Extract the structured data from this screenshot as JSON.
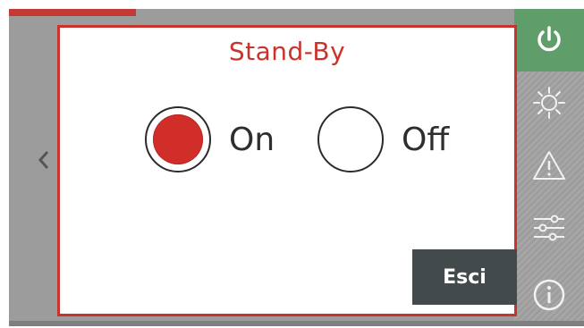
{
  "dialog": {
    "title": "Stand-By",
    "options": [
      {
        "label": "On",
        "selected": true
      },
      {
        "label": "Off",
        "selected": false
      }
    ],
    "exit_label": "Esci"
  },
  "sidebar": {
    "items": [
      {
        "icon": "power-icon",
        "active": true
      },
      {
        "icon": "sun-icon",
        "active": false
      },
      {
        "icon": "warning-icon",
        "active": false
      },
      {
        "icon": "sliders-icon",
        "active": false
      },
      {
        "icon": "info-icon",
        "active": false
      }
    ]
  },
  "colors": {
    "accent": "#c8342c",
    "power_active": "#5f9e6a",
    "button_dark": "#424a4c"
  }
}
